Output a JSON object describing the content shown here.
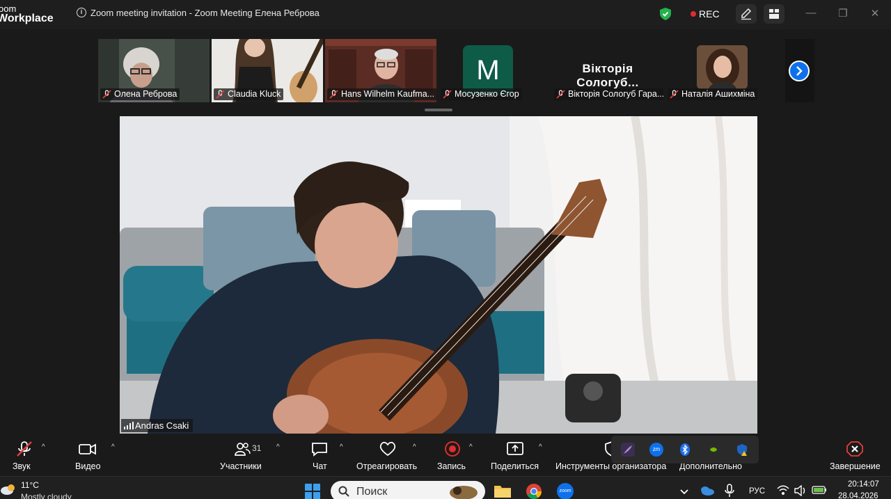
{
  "window": {
    "app_logo_line1": "oom",
    "app_logo_line2": "Workplace",
    "title": "Zoom meeting invitation - Zoom Meeting Елена Реброва",
    "rec_label": "REC"
  },
  "participants": [
    {
      "name": "Олена Реброва",
      "muted": true
    },
    {
      "name": "Claudia Kluck",
      "muted": true
    },
    {
      "name": "Hans Wilhelm Kaufma...",
      "muted": true
    },
    {
      "name": "Мосузенко Єгор",
      "muted": true,
      "avatar_letter": "M"
    },
    {
      "name": "Вікторія Сологуб Гара...",
      "muted": true,
      "tile_name": "Вікторія Сологуб..."
    },
    {
      "name": "Наталія Ашихміна",
      "muted": true
    }
  ],
  "active_speaker": {
    "name": "Andras Csaki"
  },
  "toolbar": {
    "audio": "Звук",
    "video": "Видео",
    "participants": "Участники",
    "participants_count": "31",
    "chat": "Чат",
    "react": "Отреагировать",
    "record": "Запись",
    "share": "Поделиться",
    "host_tools": "Инструменты организатора",
    "more": "Дополнительно",
    "end": "Завершение"
  },
  "taskbar": {
    "temperature": "11°C",
    "weather": "Mostly cloudy",
    "search_placeholder": "Поиск",
    "language": "РУС",
    "time": "20:14:07",
    "date": "28.04.2026"
  },
  "colors": {
    "accent": "#0e71eb",
    "record_red": "#e02d2d",
    "avatar_green": "#0e5b48",
    "end_red": "#e03e3e"
  }
}
